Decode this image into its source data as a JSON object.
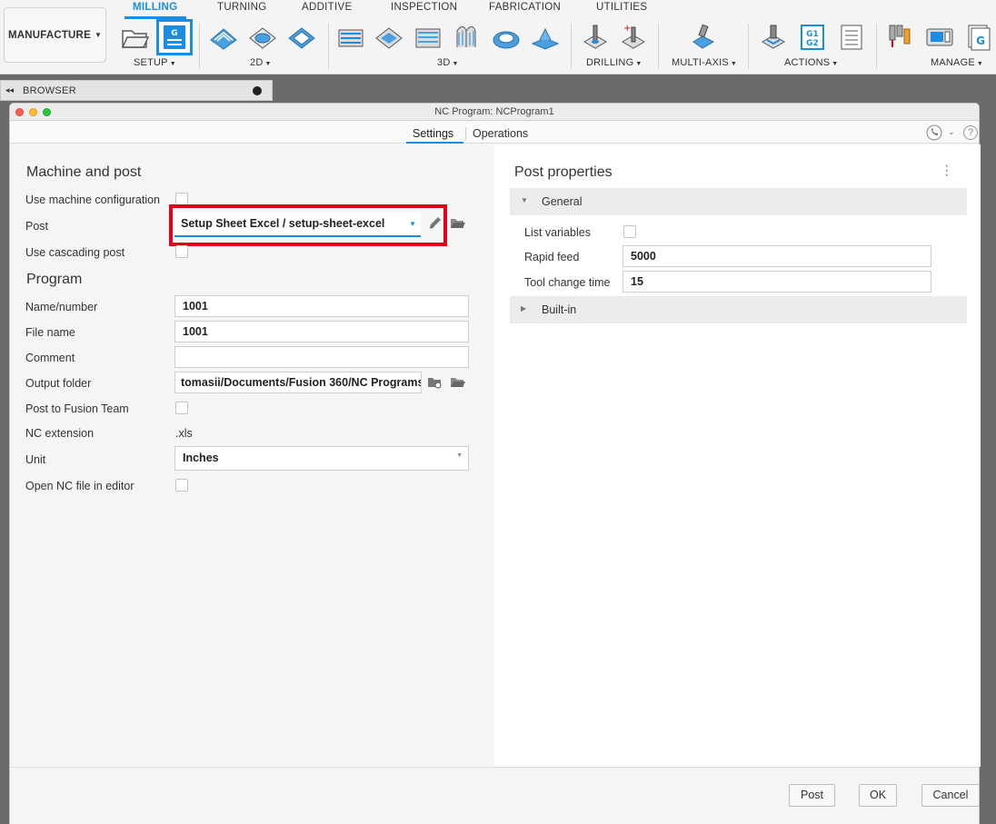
{
  "ribbon": {
    "workspace": "MANUFACTURE",
    "tabs": [
      "MILLING",
      "TURNING",
      "ADDITIVE",
      "INSPECTION",
      "FABRICATION",
      "UTILITIES"
    ],
    "groups": [
      "SETUP",
      "2D",
      "3D",
      "DRILLING",
      "MULTI-AXIS",
      "ACTIONS",
      "MANAGE"
    ],
    "nc_icon_letter": "G",
    "gcode_icon_text": [
      "G1",
      "G2"
    ],
    "manage_icon_letter": "G",
    "accent": "#1a8de0"
  },
  "browser": {
    "label": "BROWSER"
  },
  "dialog": {
    "title": "NC Program: NCProgram1",
    "tabs": {
      "settings": "Settings",
      "operations": "Operations"
    },
    "machine_section": "Machine and post",
    "use_machine_config": "Use machine configuration",
    "post_label": "Post",
    "post_value": "Setup Sheet Excel / setup-sheet-excel",
    "use_cascading_post": "Use cascading post",
    "program_section": "Program",
    "name_number_label": "Name/number",
    "name_number_value": "1001",
    "file_name_label": "File name",
    "file_name_value": "1001",
    "comment_label": "Comment",
    "comment_value": "",
    "output_folder_label": "Output folder",
    "output_folder_value": "tomasii/Documents/Fusion 360/NC Programs",
    "post_to_team_label": "Post to Fusion Team",
    "nc_extension_label": "NC extension",
    "nc_extension_value": ".xls",
    "unit_label": "Unit",
    "unit_value": "Inches",
    "open_editor_label": "Open NC file in editor",
    "help_glyph": "?",
    "post_properties": {
      "title": "Post properties",
      "general_group": "General",
      "list_variables_label": "List variables",
      "rapid_feed_label": "Rapid feed",
      "rapid_feed_value": "5000",
      "tool_change_time_label": "Tool change time",
      "tool_change_time_value": "15",
      "builtin_group": "Built-in"
    },
    "buttons": {
      "post": "Post",
      "ok": "OK",
      "cancel": "Cancel"
    },
    "highlight_color": "#e2001a"
  }
}
